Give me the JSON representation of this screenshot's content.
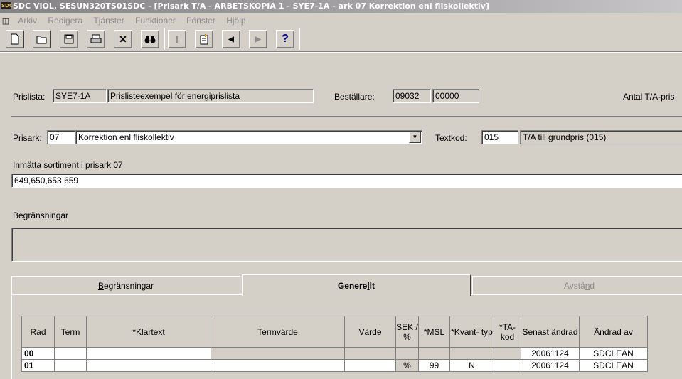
{
  "window": {
    "logo": "SDC",
    "title": "SDC VIOL, SESUN320TS01SDC - [Prisark T/A - ARBETSKOPIA 1 - SYE7-1A - ark 07 Korrektion enl fliskollektiv]"
  },
  "menu": [
    "Arkiv",
    "Redigera",
    "Tjänster",
    "Funktioner",
    "Fönster",
    "Hjälp"
  ],
  "toolbar": {
    "new": "new-document-icon",
    "open": "open-folder-icon",
    "save": "save-icon",
    "print": "print-icon",
    "delete": "delete-x-icon",
    "find": "binoculars-icon",
    "alert": "exclamation-icon",
    "notes": "notes-icon",
    "prev": "prev-arrow-icon",
    "next": "next-arrow-icon",
    "help": "help-icon",
    "delete_glyph": "✕",
    "alert_glyph": "!",
    "prev_glyph": "◀",
    "next_glyph": "▶",
    "help_glyph": "?"
  },
  "header": {
    "prislista_label": "Prislista:",
    "prislista_code": "SYE7-1A",
    "prislista_name": "Prislisteexempel för energiprislista",
    "bestallare_label": "Beställare:",
    "bestallare_1": "09032",
    "bestallare_2": "00000",
    "antal_label": "Antal T/A-pris"
  },
  "prisark": {
    "label": "Prisark:",
    "number": "07",
    "name": "Korrektion enl fliskollektiv",
    "textkod_label": "Textkod:",
    "textkod": "015",
    "textkod_text": "T/A till grundpris (015)"
  },
  "sortiment": {
    "label": "Inmätta sortiment i prisark 07",
    "value": "649,650,653,659"
  },
  "begransningar": {
    "label": "Begränsningar",
    "value": ""
  },
  "tabs": [
    {
      "pre": "",
      "u": "B",
      "post": "egränsningar"
    },
    {
      "pre": "Genere",
      "u": "l",
      "post": "lt"
    },
    {
      "pre": "Avstå",
      "u": "n",
      "post": "d"
    }
  ],
  "grid": {
    "columns": [
      "Rad",
      "Term",
      "*Klartext",
      "Termvärde",
      "Värde",
      "SEK / %",
      "*MSL",
      "*Kvant- typ",
      "*TA- kod",
      "Senast ändrad",
      "Ändrad av"
    ],
    "rows": [
      {
        "rad": "00",
        "term": "",
        "klartext": "",
        "termvarde": "",
        "varde": "",
        "sek": "",
        "msl": "",
        "kvant": "",
        "ta": "",
        "senast": "20061124",
        "andrad": "SDCLEAN"
      },
      {
        "rad": "01",
        "term": "",
        "klartext": "",
        "termvarde": "",
        "varde": "",
        "sek": "%",
        "msl": "99",
        "kvant": "N",
        "ta": "",
        "senast": "20061124",
        "andrad": "SDCLEAN"
      }
    ]
  }
}
